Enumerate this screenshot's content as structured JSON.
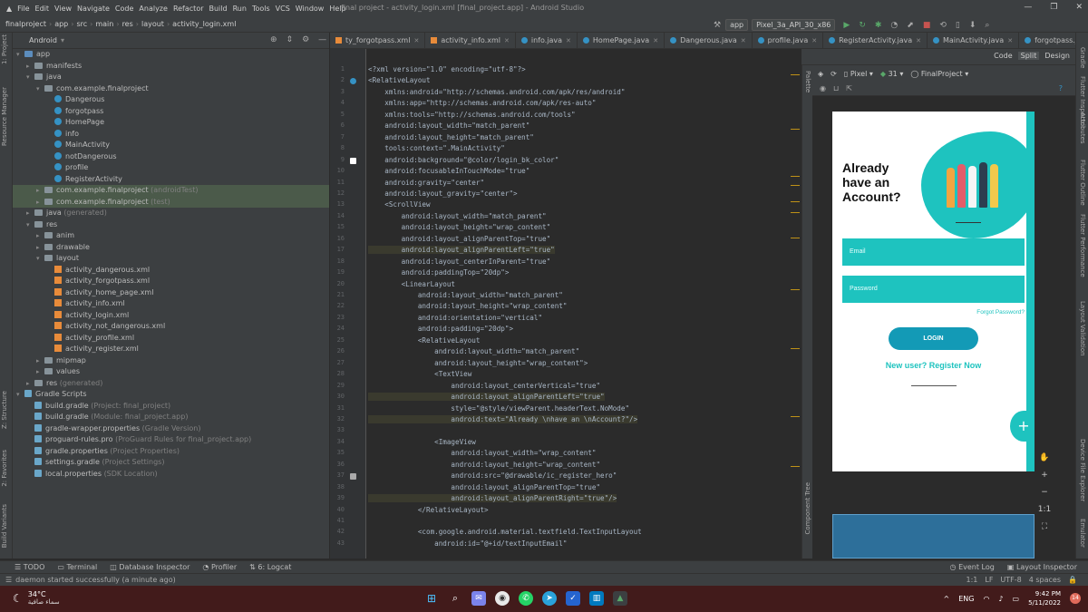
{
  "menu": {
    "items": [
      "File",
      "Edit",
      "View",
      "Navigate",
      "Code",
      "Analyze",
      "Refactor",
      "Build",
      "Run",
      "Tools",
      "VCS",
      "Window",
      "Help"
    ],
    "window_title": "final project - activity_login.xml [final_project.app] - Android Studio"
  },
  "breadcrumb": [
    "finalproject",
    "app",
    "src",
    "main",
    "res",
    "layout",
    "activity_login.xml"
  ],
  "toolbar": {
    "config": "app",
    "device": "Pixel_3a_API_30_x86"
  },
  "project": {
    "mode": "Android",
    "rows": [
      {
        "t": "app",
        "k": "fold",
        "i": 0,
        "open": true
      },
      {
        "t": "manifests",
        "k": "fold",
        "i": 1
      },
      {
        "t": "java",
        "k": "fold",
        "i": 1,
        "open": true
      },
      {
        "t": "com.example.finalproject",
        "k": "fold",
        "i": 2,
        "open": true
      },
      {
        "t": "Dangerous",
        "k": "cls",
        "i": 3
      },
      {
        "t": "forgotpass",
        "k": "cls",
        "i": 3
      },
      {
        "t": "HomePage",
        "k": "cls",
        "i": 3
      },
      {
        "t": "info",
        "k": "cls",
        "i": 3
      },
      {
        "t": "MainActivity",
        "k": "cls",
        "i": 3
      },
      {
        "t": "notDangerous",
        "k": "cls",
        "i": 3
      },
      {
        "t": "profile",
        "k": "cls",
        "i": 3
      },
      {
        "t": "RegisterActivity",
        "k": "cls",
        "i": 3
      },
      {
        "t": "com.example.finalproject",
        "d": "(androidTest)",
        "k": "fold",
        "i": 2,
        "sel": true
      },
      {
        "t": "com.example.finalproject",
        "d": "(test)",
        "k": "fold",
        "i": 2,
        "sel": true
      },
      {
        "t": "java",
        "d": "(generated)",
        "k": "fold",
        "i": 1
      },
      {
        "t": "res",
        "k": "fold",
        "i": 1,
        "open": true
      },
      {
        "t": "anim",
        "k": "fold",
        "i": 2
      },
      {
        "t": "drawable",
        "k": "fold",
        "i": 2
      },
      {
        "t": "layout",
        "k": "fold",
        "i": 2,
        "open": true
      },
      {
        "t": "activity_dangerous.xml",
        "k": "xml",
        "i": 3
      },
      {
        "t": "activity_forgotpass.xml",
        "k": "xml",
        "i": 3
      },
      {
        "t": "activity_home_page.xml",
        "k": "xml",
        "i": 3
      },
      {
        "t": "activity_info.xml",
        "k": "xml",
        "i": 3
      },
      {
        "t": "activity_login.xml",
        "k": "xml",
        "i": 3
      },
      {
        "t": "activity_not_dangerous.xml",
        "k": "xml",
        "i": 3
      },
      {
        "t": "activity_profile.xml",
        "k": "xml",
        "i": 3
      },
      {
        "t": "activity_register.xml",
        "k": "xml",
        "i": 3
      },
      {
        "t": "mipmap",
        "k": "fold",
        "i": 2
      },
      {
        "t": "values",
        "k": "fold",
        "i": 2
      },
      {
        "t": "res",
        "d": "(generated)",
        "k": "fold",
        "i": 1
      },
      {
        "t": "Gradle Scripts",
        "k": "gr",
        "i": 0,
        "open": true
      },
      {
        "t": "build.gradle",
        "d": "(Project: final_project)",
        "k": "gr",
        "i": 1
      },
      {
        "t": "build.gradle",
        "d": "(Module: final_project.app)",
        "k": "gr",
        "i": 1
      },
      {
        "t": "gradle-wrapper.properties",
        "d": "(Gradle Version)",
        "k": "gr",
        "i": 1
      },
      {
        "t": "proguard-rules.pro",
        "d": "(ProGuard Rules for final_project.app)",
        "k": "gr",
        "i": 1
      },
      {
        "t": "gradle.properties",
        "d": "(Project Properties)",
        "k": "gr",
        "i": 1
      },
      {
        "t": "settings.gradle",
        "d": "(Project Settings)",
        "k": "gr",
        "i": 1
      },
      {
        "t": "local.properties",
        "d": "(SDK Location)",
        "k": "gr",
        "i": 1
      }
    ]
  },
  "side_left": [
    "1: Project",
    "Resource Manager",
    "Z: Structure",
    "2: Favorites",
    "Build Variants"
  ],
  "side_right": [
    "Gradle",
    "Flutter Inspector",
    "Attributes",
    "Flutter Outline",
    "Flutter Performance",
    "Layout Validation",
    "Device File Explorer",
    "Emulator"
  ],
  "tabs": [
    {
      "label": "ty_forgotpass.xml",
      "k": "x"
    },
    {
      "label": "activity_info.xml",
      "k": "x"
    },
    {
      "label": "info.java",
      "k": "c"
    },
    {
      "label": "HomePage.java",
      "k": "c"
    },
    {
      "label": "Dangerous.java",
      "k": "c"
    },
    {
      "label": "profile.java",
      "k": "c"
    },
    {
      "label": "RegisterActivity.java",
      "k": "c"
    },
    {
      "label": "MainActivity.java",
      "k": "c"
    },
    {
      "label": "forgotpass.java",
      "k": "c"
    },
    {
      "label": "activity_login.xml",
      "k": "x",
      "active": true
    }
  ],
  "view_switch": [
    "Code",
    "Split",
    "Design"
  ],
  "design_toolbar": {
    "device": "Pixel",
    "api": "31",
    "theme": "FinalProject"
  },
  "palette_label": "Palette",
  "component_tree_label": "Component Tree",
  "code": [
    "<?xml version=\"1.0\" encoding=\"utf-8\"?>",
    "<RelativeLayout",
    "    xmlns:android=\"http://schemas.android.com/apk/res/android\"",
    "    xmlns:app=\"http://schemas.android.com/apk/res-auto\"",
    "    xmlns:tools=\"http://schemas.android.com/tools\"",
    "    android:layout_width=\"match_parent\"",
    "    android:layout_height=\"match_parent\"",
    "    tools:context=\".MainActivity\"",
    "    android:background=\"@color/login_bk_color\"",
    "    android:focusableInTouchMode=\"true\"",
    "    android:gravity=\"center\"",
    "    android:layout_gravity=\"center\">",
    "    <ScrollView",
    "        android:layout_width=\"match_parent\"",
    "        android:layout_height=\"wrap_content\"",
    "        android:layout_alignParentTop=\"true\"",
    "        android:layout_alignParentLeft=\"true\"",
    "        android:layout_centerInParent=\"true\"",
    "        android:paddingTop=\"20dp\">",
    "        <LinearLayout",
    "            android:layout_width=\"match_parent\"",
    "            android:layout_height=\"wrap_content\"",
    "            android:orientation=\"vertical\"",
    "            android:padding=\"20dp\">",
    "            <RelativeLayout",
    "                android:layout_width=\"match_parent\"",
    "                android:layout_height=\"wrap_content\">",
    "                <TextView",
    "                    android:layout_centerVertical=\"true\"",
    "                    android:layout_alignParentLeft=\"true\"",
    "                    style=\"@style/viewParent.headerText.NoMode\"",
    "                    android:text=\"Already \\nhave an \\nAccount?\"/>",
    "",
    "                <ImageView",
    "                    android:layout_width=\"wrap_content\"",
    "                    android:layout_height=\"wrap_content\"",
    "                    android:src=\"@drawable/ic_register_hero\"",
    "                    android:layout_alignParentTop=\"true\"",
    "                    android:layout_alignParentRight=\"true\"/>",
    "            </RelativeLayout>",
    "",
    "            <com.google.android.material.textfield.TextInputLayout",
    "                android:id=\"@+id/textInputEmail\""
  ],
  "preview": {
    "heading": "Already\nhave an\nAccount?",
    "email_hint": "Email",
    "password_hint": "Password",
    "forgot": "Forgot Password?",
    "login": "LOGIN",
    "new_user": "New user? Register Now",
    "fab": "+"
  },
  "bottom_tools": [
    "TODO",
    "Terminal",
    "Database Inspector",
    "Profiler",
    "6: Logcat"
  ],
  "bottom_tools_right": [
    "Event Log",
    "Layout Inspector"
  ],
  "status": {
    "message": "daemon started successfully (a minute ago)",
    "pos": "1:1",
    "lf": "LF",
    "enc": "UTF-8",
    "indent": "4 spaces"
  },
  "taskbar": {
    "temp": "34°C",
    "weather": "سماء صافية",
    "lang": "ENG",
    "time": "9:42 PM",
    "date": "5/11/2022",
    "notifications": "14"
  }
}
